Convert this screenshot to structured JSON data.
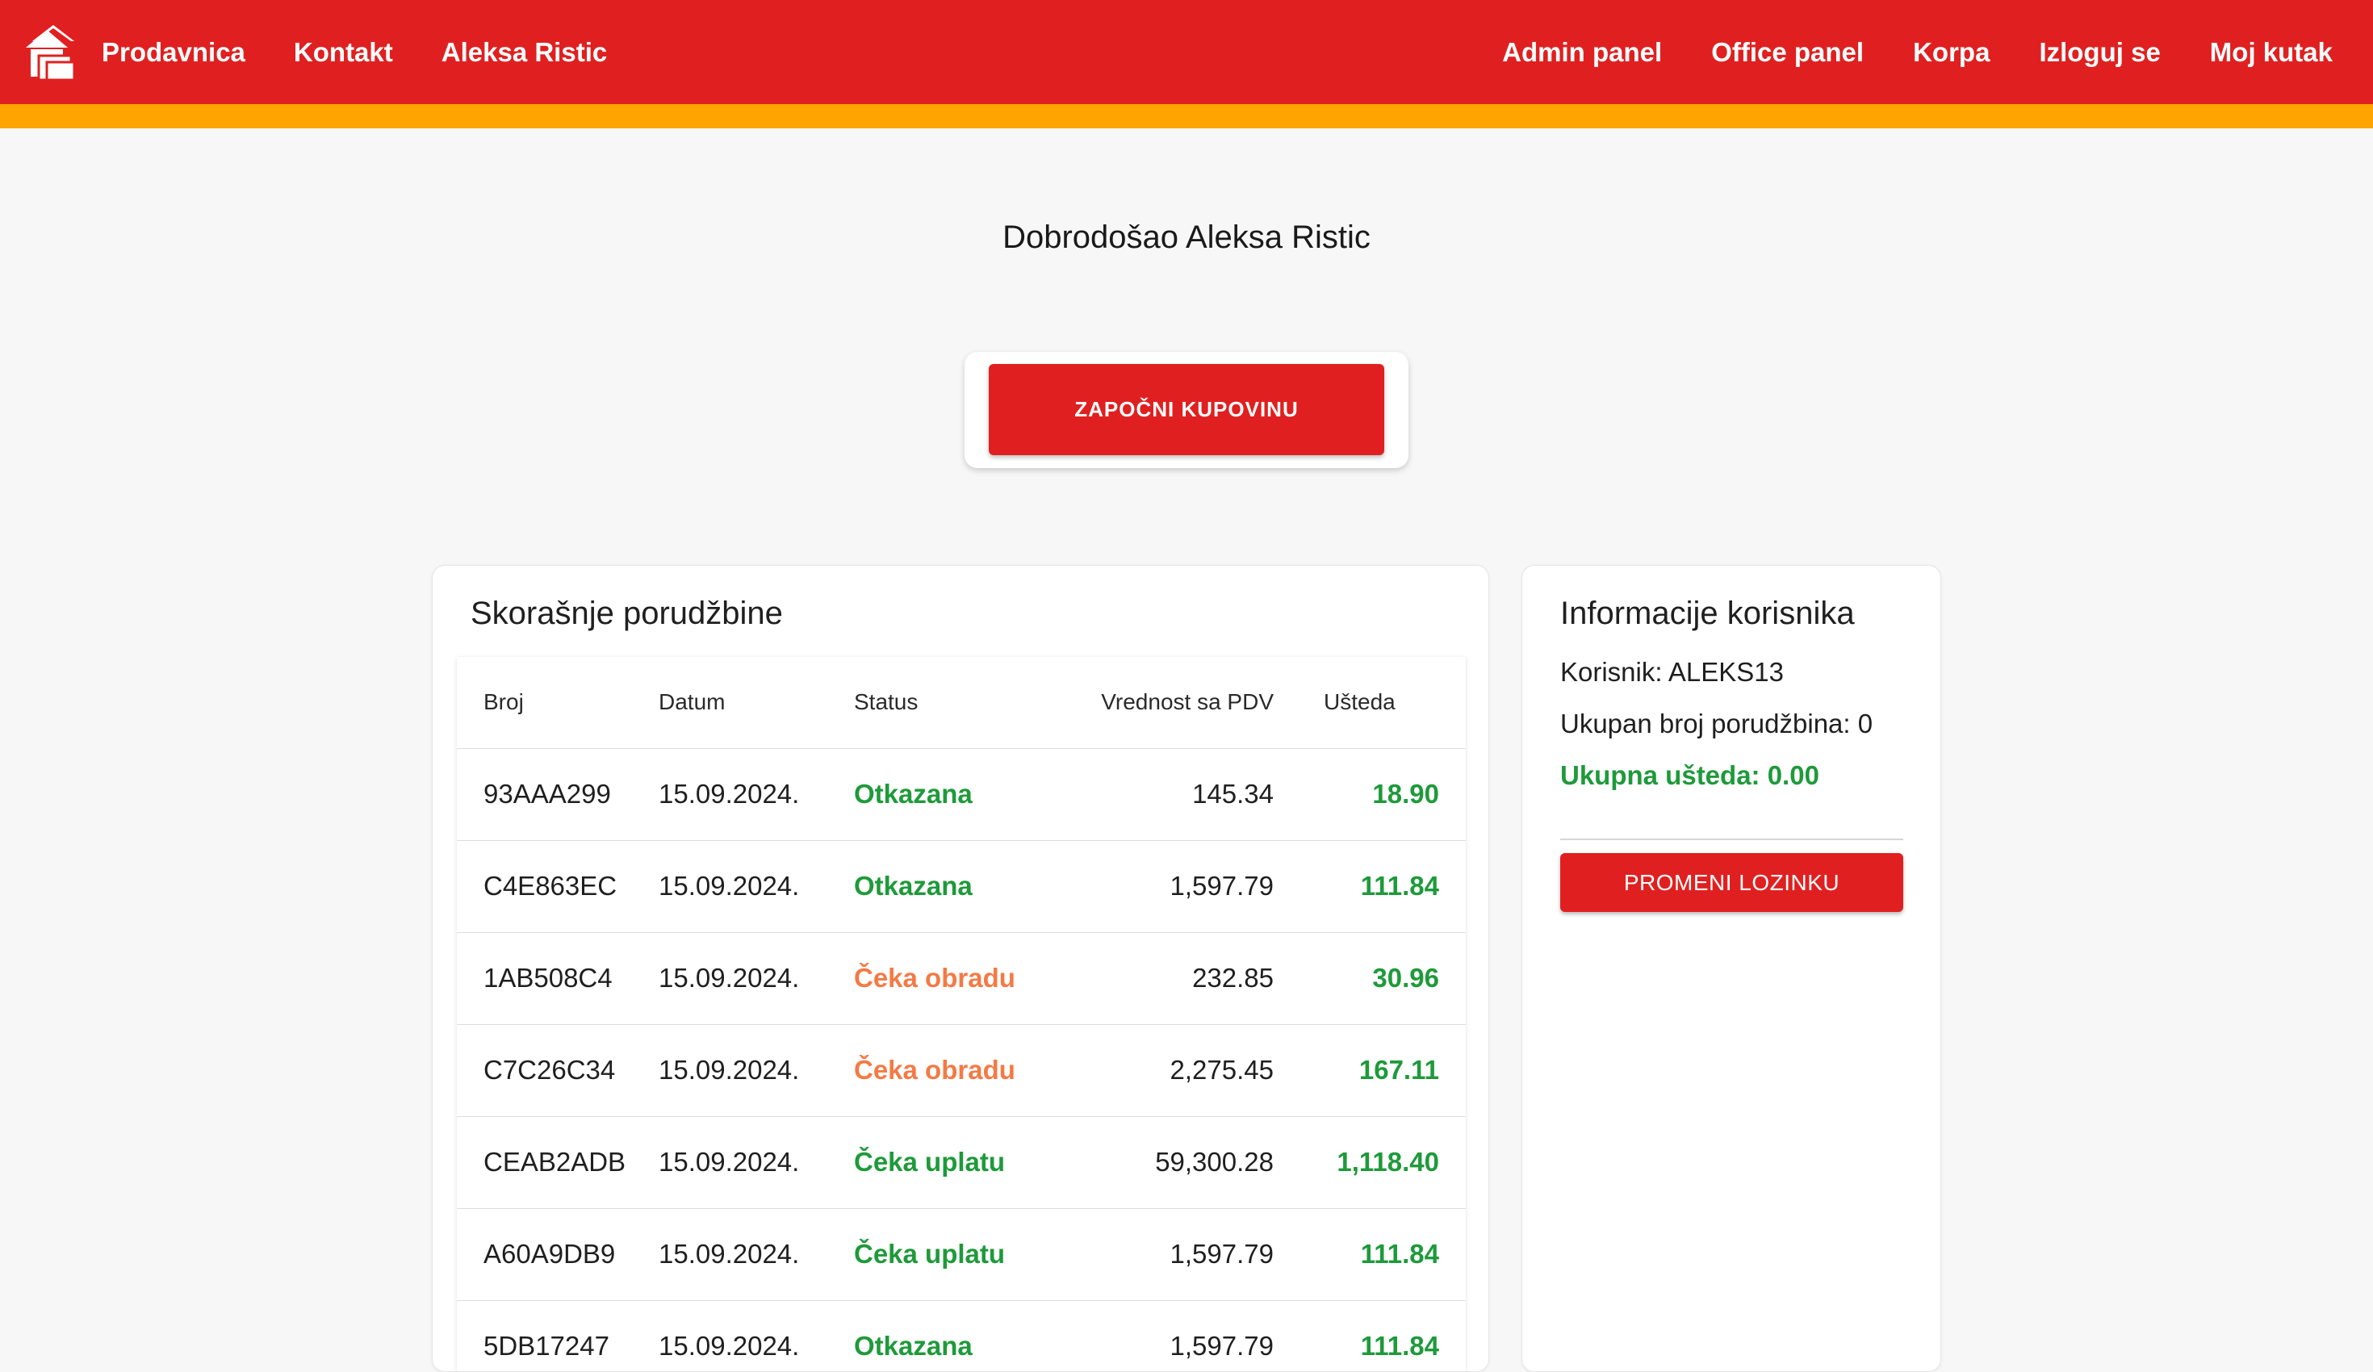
{
  "nav": {
    "brand": "Prodavnica",
    "left": [
      "Kontakt",
      "Aleksa Ristic"
    ],
    "right": [
      "Admin panel",
      "Office panel",
      "Korpa",
      "Izloguj se",
      "Moj kutak"
    ]
  },
  "welcome": {
    "text": "Dobrodošao Aleksa Ristic",
    "cta": "ZAPOČNI KUPOVINU"
  },
  "orders": {
    "title": "Skorašnje porudžbine",
    "columns": [
      "Broj",
      "Datum",
      "Status",
      "Vrednost sa PDV",
      "Ušteda"
    ],
    "rows": [
      {
        "broj": "93AAA299",
        "datum": "15.09.2024.",
        "status": "Otkazana",
        "vrednost": "145.34",
        "usteda": "18.90"
      },
      {
        "broj": "C4E863EC",
        "datum": "15.09.2024.",
        "status": "Otkazana",
        "vrednost": "1,597.79",
        "usteda": "111.84"
      },
      {
        "broj": "1AB508C4",
        "datum": "15.09.2024.",
        "status": "Čeka obradu",
        "vrednost": "232.85",
        "usteda": "30.96"
      },
      {
        "broj": "C7C26C34",
        "datum": "15.09.2024.",
        "status": "Čeka obradu",
        "vrednost": "2,275.45",
        "usteda": "167.11"
      },
      {
        "broj": "CEAB2ADB",
        "datum": "15.09.2024.",
        "status": "Čeka uplatu",
        "vrednost": "59,300.28",
        "usteda": "1,118.40"
      },
      {
        "broj": "A60A9DB9",
        "datum": "15.09.2024.",
        "status": "Čeka uplatu",
        "vrednost": "1,597.79",
        "usteda": "111.84"
      },
      {
        "broj": "5DB17247",
        "datum": "15.09.2024.",
        "status": "Otkazana",
        "vrednost": "1,597.79",
        "usteda": "111.84"
      }
    ]
  },
  "user_info": {
    "title": "Informacije korisnika",
    "user_line": "Korisnik: ALEKS13",
    "orders_count_line": "Ukupan broj porudžbina: 0",
    "savings_line": "Ukupna ušteda: 0.00",
    "change_password": "PROMENI LOZINKU"
  },
  "colors": {
    "primary_red": "#e02020",
    "accent_orange": "#ffa400",
    "status_green": "#1e9a3a",
    "status_orange": "#f47a45"
  }
}
